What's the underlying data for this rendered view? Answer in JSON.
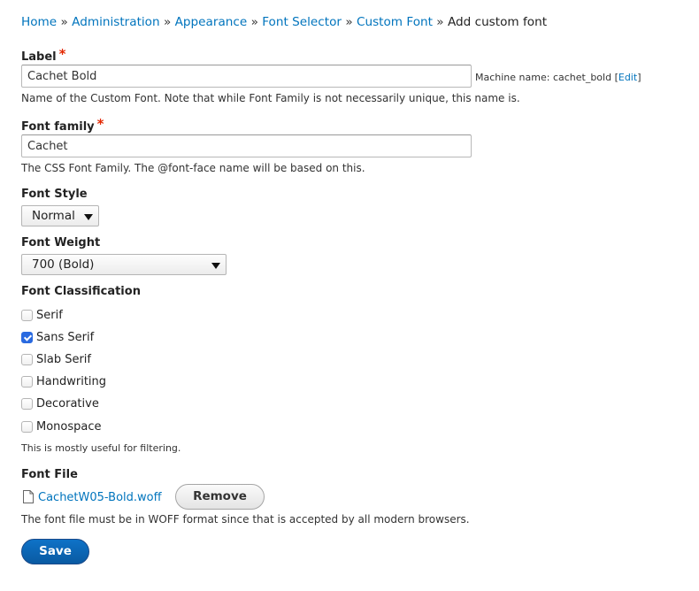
{
  "breadcrumb": {
    "items": [
      "Home",
      "Administration",
      "Appearance",
      "Font Selector",
      "Custom Font"
    ],
    "separator": "»",
    "current": "Add custom font"
  },
  "label_field": {
    "label": "Label",
    "required_mark": "*",
    "value": "Cachet Bold",
    "machine_name_prefix": "Machine name: cachet_bold [",
    "machine_name_edit": "Edit",
    "machine_name_suffix": "]",
    "description": "Name of the Custom Font. Note that while Font Family is not necessarily unique, this name is."
  },
  "font_family_field": {
    "label": "Font family",
    "required_mark": "*",
    "value": "Cachet",
    "description": "The CSS Font Family. The @font-face name will be based on this."
  },
  "font_style": {
    "label": "Font Style",
    "selected": "Normal"
  },
  "font_weight": {
    "label": "Font Weight",
    "selected": "700 (Bold)"
  },
  "font_classification": {
    "label": "Font Classification",
    "options": [
      {
        "label": "Serif",
        "checked": false
      },
      {
        "label": "Sans Serif",
        "checked": true
      },
      {
        "label": "Slab Serif",
        "checked": false
      },
      {
        "label": "Handwriting",
        "checked": false
      },
      {
        "label": "Decorative",
        "checked": false
      },
      {
        "label": "Monospace",
        "checked": false
      }
    ],
    "description": "This is mostly useful for filtering."
  },
  "font_file": {
    "label": "Font File",
    "file_name": "CachetW05-Bold.woff",
    "file_icon": "file-icon",
    "remove_label": "Remove",
    "description": "The font file must be in WOFF format since that is accepted by all modern browsers."
  },
  "actions": {
    "save_label": "Save"
  },
  "colors": {
    "link": "#0074bd",
    "required": "#e32700",
    "primary_button": "#0a64b4",
    "checkbox_checked": "#2a6ae0"
  }
}
